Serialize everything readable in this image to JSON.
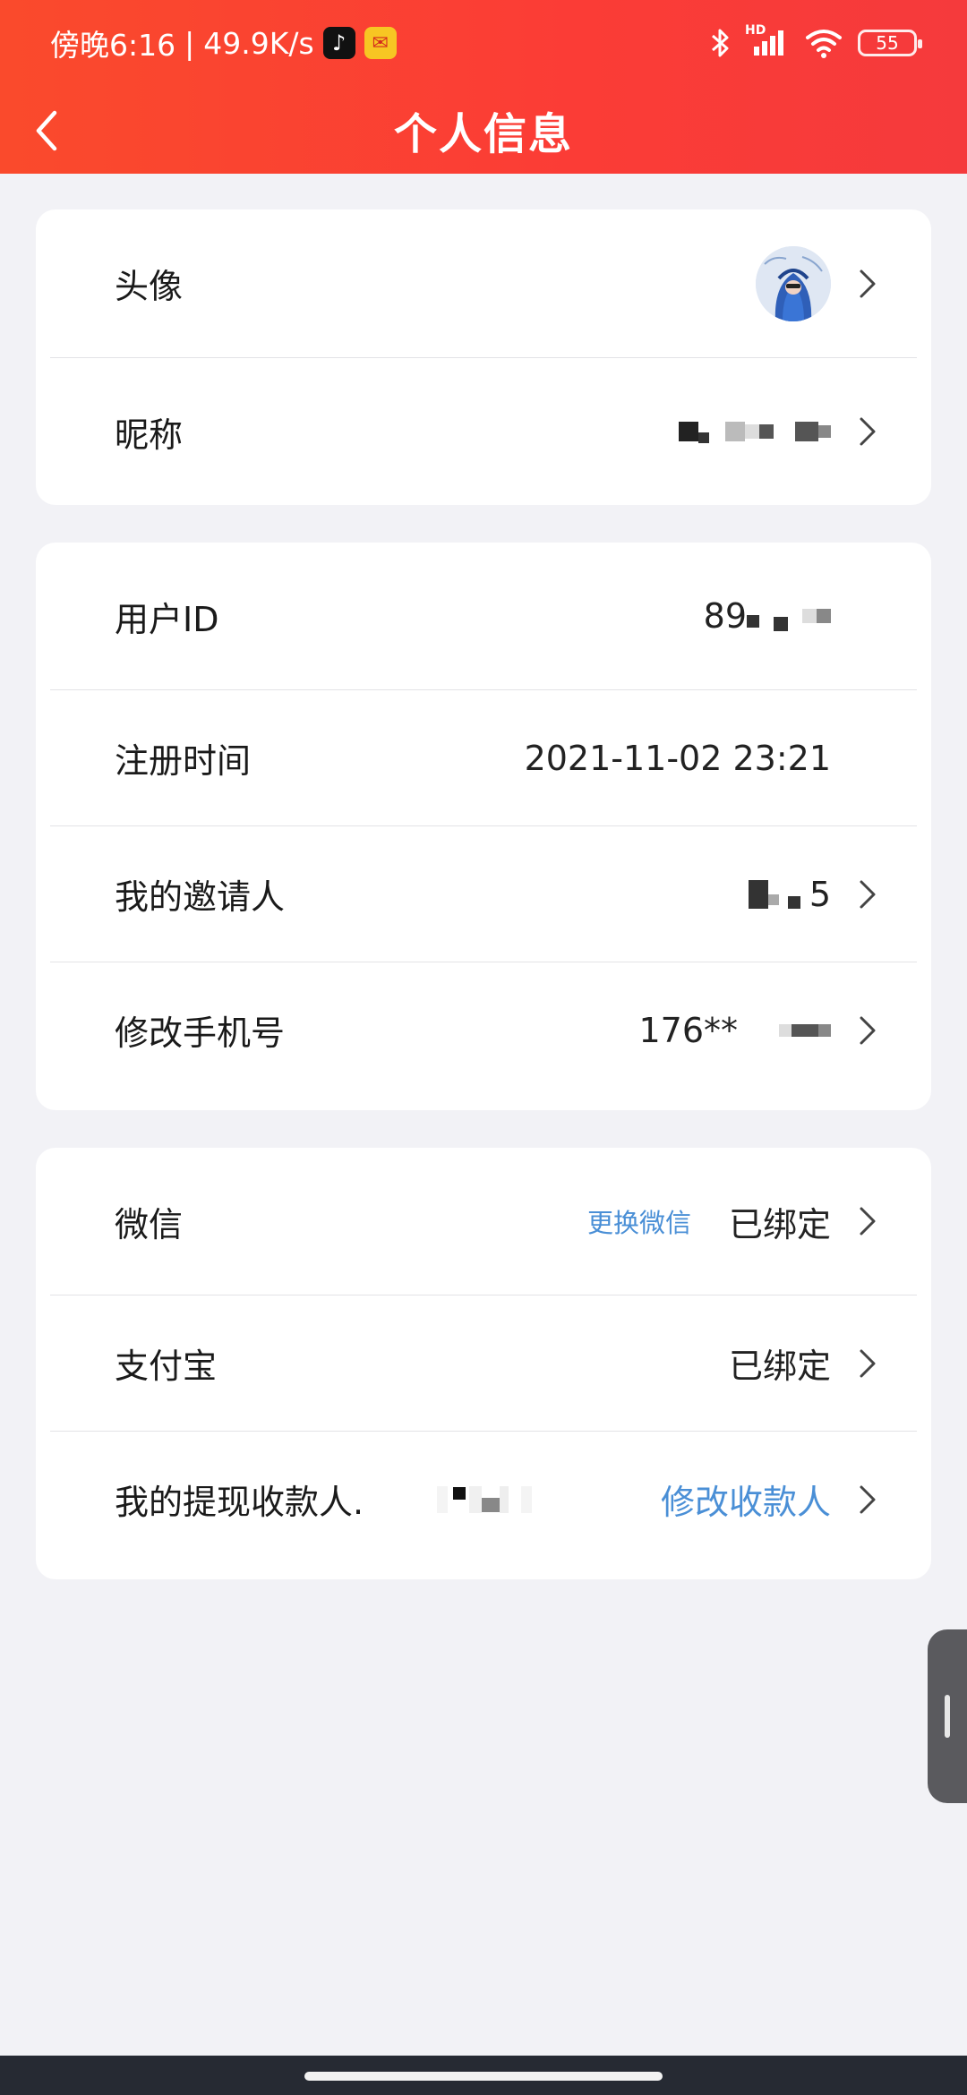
{
  "status_bar": {
    "time": "傍晚6:16",
    "separator": "|",
    "speed": "49.9K/s",
    "network": "HD",
    "battery": "55"
  },
  "nav": {
    "title": "个人信息"
  },
  "profile": {
    "avatar_label": "头像",
    "nickname_label": "昵称"
  },
  "account": {
    "user_id_label": "用户ID",
    "user_id_value": "89",
    "register_label": "注册时间",
    "register_value": "2021-11-02 23:21",
    "inviter_label": "我的邀请人",
    "inviter_value": "5",
    "phone_label": "修改手机号",
    "phone_value": "176**"
  },
  "bindings": {
    "wechat_label": "微信",
    "wechat_change": "更换微信",
    "wechat_status": "已绑定",
    "alipay_label": "支付宝",
    "alipay_status": "已绑定",
    "payee_label": "我的提现收款人.",
    "payee_action": "修改收款人"
  },
  "colors": {
    "header_start": "#fa4a2c",
    "header_end": "#f53a3c",
    "link": "#4a8fd6",
    "background": "#f2f2f6"
  },
  "icons": [
    "back-arrow-icon",
    "chevron-right-icon",
    "bluetooth-icon",
    "signal-icon",
    "wifi-icon",
    "battery-icon"
  ]
}
